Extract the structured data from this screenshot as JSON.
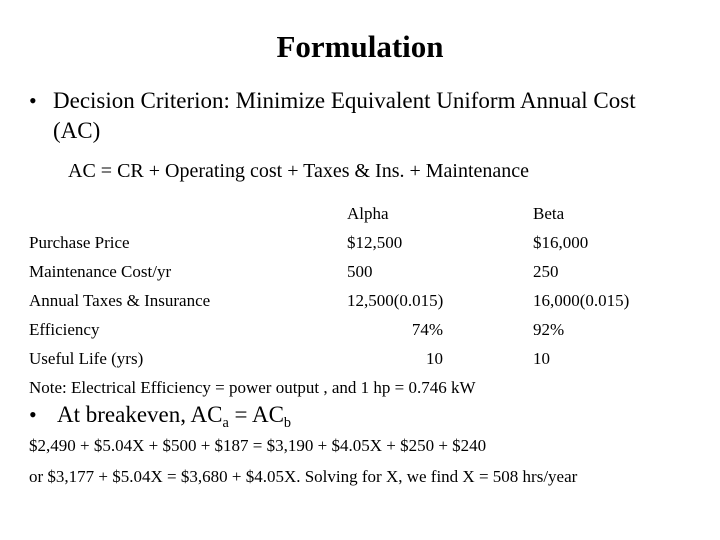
{
  "slide": {
    "title": "Formulation",
    "bullet1": {
      "marker": "•",
      "text": "Decision Criterion: Minimize Equivalent Uniform Annual Cost (AC)"
    },
    "equation_line": "AC = CR + Operating cost + Taxes & Ins. + Maintenance",
    "table": {
      "columns": [
        "",
        "Alpha",
        "Beta"
      ],
      "header_alpha": "Alpha",
      "header_beta": "Beta",
      "rows": [
        {
          "label": "Purchase Price",
          "alpha": "$12,500",
          "beta": "$16,000",
          "alpha_align": "left"
        },
        {
          "label": "Maintenance Cost/yr",
          "alpha": "500",
          "beta": "250",
          "alpha_align": "left"
        },
        {
          "label": "Annual Taxes & Insurance",
          "alpha": "12,500(0.015)",
          "beta": "16,000(0.015)",
          "alpha_align": "left"
        },
        {
          "label": "Efficiency",
          "alpha": "74%",
          "beta": "92%",
          "alpha_align": "right"
        },
        {
          "label": "Useful Life (yrs)",
          "alpha": "10",
          "beta": "10",
          "alpha_align": "right"
        }
      ]
    },
    "note": "Note: Electrical Efficiency = power output , and 1 hp = 0.746 kW",
    "bullet2": {
      "marker": "•",
      "prefix": "At breakeven, AC",
      "sub_a": "a",
      "middle": " = AC",
      "sub_b": "b"
    },
    "equation_1": "$2,490 + $5.04X + $500 + $187 = $3,190 + $4.05X + $250 + $240",
    "equation_2": "or $3,177 + $5.04X = $3,680 + $4.05X. Solving for X, we find X = 508 hrs/year",
    "colors": {
      "background": "#ffffff",
      "text": "#000000"
    }
  }
}
